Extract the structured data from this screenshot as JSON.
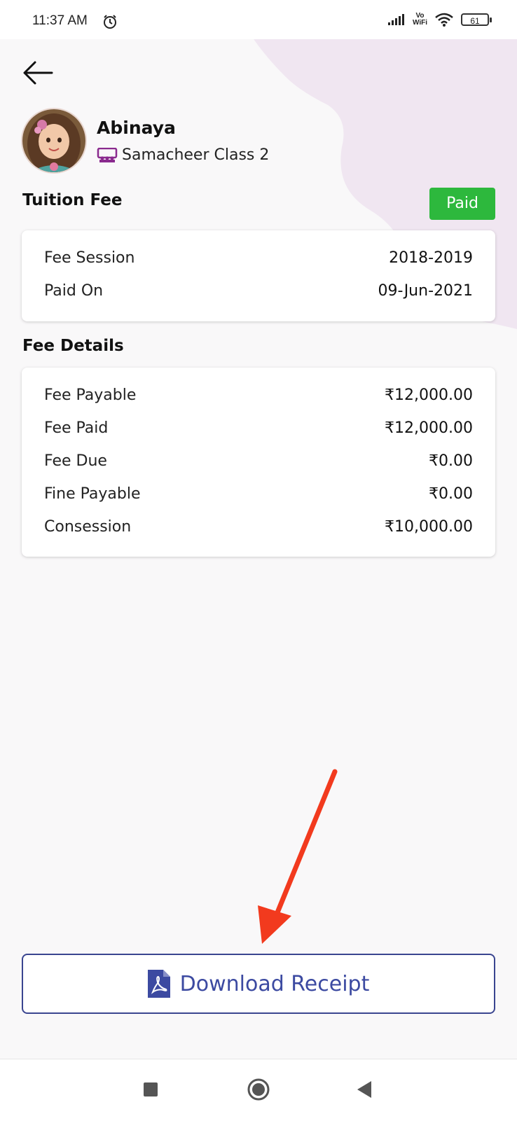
{
  "status_bar": {
    "time": "11:37 AM",
    "vo_label": "Vo",
    "wifi_label": "WiFi",
    "battery": "61",
    "icons": [
      "alarm-icon",
      "signal-icon",
      "wifi-icon",
      "battery-icon"
    ]
  },
  "header": {
    "back_icon": "back-arrow-icon"
  },
  "student": {
    "name": "Abinaya",
    "class_name": "Samacheer Class 2",
    "class_icon": "classroom-icon"
  },
  "tuition": {
    "title": "Tuition Fee",
    "status": "Paid",
    "rows": [
      {
        "label": "Fee Session",
        "value": "2018-2019"
      },
      {
        "label": "Paid On",
        "value": "09-Jun-2021"
      }
    ]
  },
  "fee_details": {
    "title": "Fee Details",
    "rows": [
      {
        "label": "Fee Payable",
        "value": "₹12,000.00"
      },
      {
        "label": "Fee Paid",
        "value": "₹12,000.00"
      },
      {
        "label": "Fee Due",
        "value": "₹0.00"
      },
      {
        "label": "Fine Payable",
        "value": "₹0.00"
      },
      {
        "label": "Consession",
        "value": "₹10,000.00"
      }
    ]
  },
  "download": {
    "label": "Download Receipt",
    "icon": "pdf-icon"
  },
  "colors": {
    "paid_badge": "#2db83d",
    "button_text": "#3c4aa1",
    "button_border": "#3a4590",
    "accent_purple": "#8a2a8e",
    "annotation_arrow": "#f23a1e",
    "background_blob": "#efe3f0"
  },
  "nav_bar": {
    "icons": [
      "recents-square-icon",
      "home-circle-icon",
      "back-triangle-icon"
    ]
  }
}
